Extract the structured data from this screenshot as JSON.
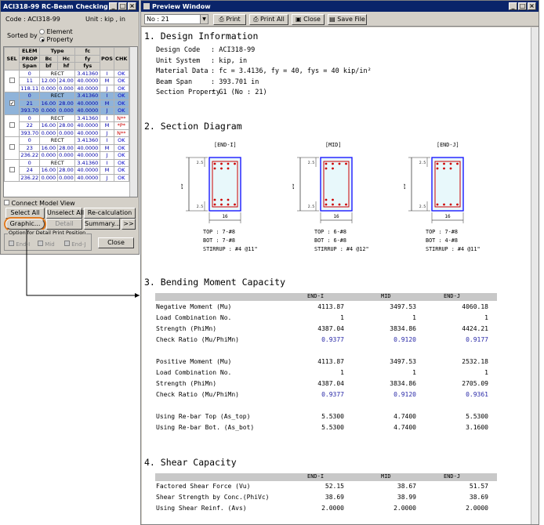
{
  "dialog": {
    "title": "ACI318-99 RC-Beam Checking Result Dial...",
    "code_label": "Code : ACI318-99",
    "unit_label": "Unit :  kip  ,  in",
    "sorted_by": "Sorted by",
    "sort_options": [
      "Element",
      "Property"
    ],
    "grid_headers": {
      "sel": "SEL",
      "elem": "ELEM",
      "type": "Type",
      "fc": "fc",
      "prop": "PROP",
      "bc": "Bc",
      "hc": "Hc",
      "fy": "fy",
      "span": "Span",
      "bf": "bf",
      "hf": "hf",
      "fys": "fys",
      "pos": "POS",
      "chk": "CHK"
    },
    "groups": [
      {
        "elem": "0",
        "type": "RECT",
        "fc": "3.41360",
        "pos1": "I",
        "chk1": "OK",
        "prop": "11",
        "bc": "12.00",
        "hc": "24.00",
        "fy": "40.0000",
        "pos2": "M",
        "chk2": "OK",
        "span": "118.11",
        "bf": "0.000",
        "hf": "0.000",
        "fys": "40.0000",
        "pos3": "J",
        "chk3": "OK"
      },
      {
        "elem": "0",
        "type": "RECT",
        "fc": "3.41360",
        "pos1": "I",
        "chk1": "OK",
        "prop": "21",
        "bc": "16.00",
        "hc": "28.00",
        "fy": "40.0000",
        "pos2": "M",
        "chk2": "OK",
        "span": "393.70",
        "bf": "0.000",
        "hf": "0.000",
        "fys": "40.0000",
        "pos3": "J",
        "chk3": "OK"
      },
      {
        "elem": "0",
        "type": "RECT",
        "fc": "3.41360",
        "pos1": "I",
        "chk1": "N**",
        "prop": "22",
        "bc": "16.00",
        "hc": "28.00",
        "fy": "40.0000",
        "pos2": "M",
        "chk2": "*P*",
        "span": "393.70",
        "bf": "0.000",
        "hf": "0.000",
        "fys": "40.0000",
        "pos3": "J",
        "chk3": "N**"
      },
      {
        "elem": "0",
        "type": "RECT",
        "fc": "3.41360",
        "pos1": "I",
        "chk1": "OK",
        "prop": "23",
        "bc": "16.00",
        "hc": "28.00",
        "fy": "40.0000",
        "pos2": "M",
        "chk2": "OK",
        "span": "236.22",
        "bf": "0.000",
        "hf": "0.000",
        "fys": "40.0000",
        "pos3": "J",
        "chk3": "OK"
      },
      {
        "elem": "0",
        "type": "RECT",
        "fc": "3.41360",
        "pos1": "I",
        "chk1": "OK",
        "prop": "24",
        "bc": "16.00",
        "hc": "28.00",
        "fy": "40.0000",
        "pos2": "M",
        "chk2": "OK",
        "span": "236.22",
        "bf": "0.000",
        "hf": "0.000",
        "fys": "40.0000",
        "pos3": "J",
        "chk3": "OK"
      }
    ],
    "connect_model_view": "Connect Model View",
    "buttons": {
      "select_all": "Select All",
      "unselect_all": "Unselect All",
      "recalc": "Re-calculation",
      "graphic": "Graphic...",
      "detail": "Detail",
      "summary": "Summary...",
      "more": ">>",
      "close": "Close"
    },
    "option_group": "Option for Detail Print Position",
    "option_items": [
      "End-I",
      "Mid",
      "End-J"
    ]
  },
  "preview": {
    "title": "Preview Window",
    "combo_value": "No : 21",
    "toolbar": {
      "print": "Print",
      "print_all": "Print All",
      "close": "Close",
      "save_file": "Save File"
    },
    "sections": {
      "s1": "1. Design Information",
      "s2": "2. Section Diagram",
      "s3": "3. Bending Moment Capacity",
      "s4": "4. Shear Capacity"
    },
    "design_info": [
      {
        "k": "Design Code",
        "v": ":  ACI318-99"
      },
      {
        "k": "Unit System",
        "v": ":  kip, in"
      },
      {
        "k": "Material Data",
        "v": ":  fc = 3.4136,     fy = 40,     fys = 40 kip/in²"
      },
      {
        "k": "Beam Span",
        "v": ":  393.701 in"
      },
      {
        "k": "Section Property",
        "v": ":  G1 (No : 21)"
      }
    ],
    "diagrams": [
      {
        "label": "[END-I]",
        "width": "16",
        "height": "28",
        "cover": "2.5",
        "top": "TOP  :  7-#8",
        "bot": "BOT  :  7-#8",
        "stirrup": "STIRRUP : #4  @11\""
      },
      {
        "label": "[MID]",
        "width": "16",
        "height": "28",
        "cover": "2.5",
        "top": "TOP  :  6-#8",
        "bot": "BOT  :  6-#8",
        "stirrup": "STIRRUP : #4  @12\""
      },
      {
        "label": "[END-J]",
        "width": "16",
        "height": "28",
        "cover": "2.5",
        "top": "TOP  :  7-#8",
        "bot": "BOT  :  4-#8",
        "stirrup": "STIRRUP : #4  @11\""
      }
    ],
    "col_headers": [
      "END-I",
      "MID",
      "END-J"
    ],
    "bending": [
      {
        "l": "Negative Moment (Mu)",
        "v": [
          "4113.87",
          "3497.53",
          "4060.18"
        ],
        "blue": false
      },
      {
        "l": "Load Combination No.",
        "v": [
          "1",
          "1",
          "1"
        ],
        "blue": false
      },
      {
        "l": "Strength (PhiMn)",
        "v": [
          "4387.04",
          "3834.86",
          "4424.21"
        ],
        "blue": false
      },
      {
        "l": "Check Ratio (Mu/PhiMn)",
        "v": [
          "0.9377",
          "0.9120",
          "0.9177"
        ],
        "blue": true
      },
      {
        "l": "Positive Moment (Mu)",
        "v": [
          "4113.87",
          "3497.53",
          "2532.18"
        ],
        "blue": false
      },
      {
        "l": "Load Combination No.",
        "v": [
          "1",
          "1",
          "1"
        ],
        "blue": false
      },
      {
        "l": "Strength (PhiMn)",
        "v": [
          "4387.04",
          "3834.86",
          "2705.09"
        ],
        "blue": false
      },
      {
        "l": "Check Ratio (Mu/PhiMn)",
        "v": [
          "0.9377",
          "0.9120",
          "0.9361"
        ],
        "blue": true
      },
      {
        "l": "Using Re-bar Top  (As_top)",
        "v": [
          "5.5300",
          "4.7400",
          "5.5300"
        ],
        "blue": false
      },
      {
        "l": "Using Re-bar Bot. (As_bot)",
        "v": [
          "5.5300",
          "4.7400",
          "3.1600"
        ],
        "blue": false
      }
    ],
    "shear": [
      {
        "l": "Factored Shear Force (Vu)",
        "v": [
          "52.15",
          "38.67",
          "51.57"
        ]
      },
      {
        "l": "Shear Strength by Conc.(PhiVc)",
        "v": [
          "38.69",
          "38.99",
          "38.69"
        ]
      },
      {
        "l": "Using Shear Reinf. (Avs)",
        "v": [
          "2.0000",
          "2.0000",
          "2.0000"
        ]
      }
    ]
  }
}
